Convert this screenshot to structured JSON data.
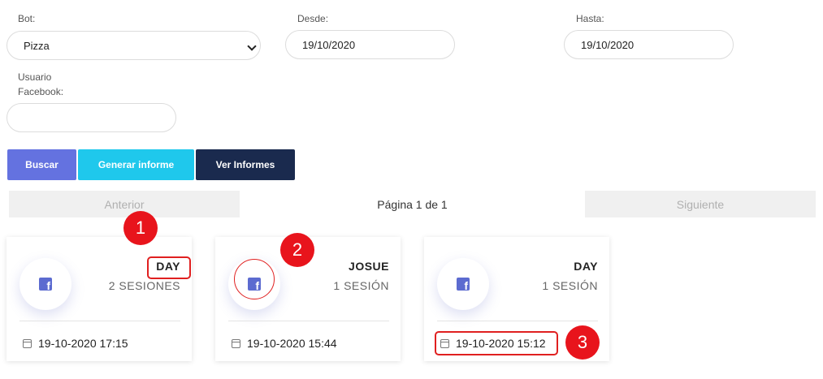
{
  "filters": {
    "bot_label": "Bot:",
    "bot_value": "Pizza",
    "desde_label": "Desde:",
    "desde_value": "19/10/2020",
    "hasta_label": "Hasta:",
    "hasta_value": "19/10/2020",
    "usuario_label_1": "Usuario",
    "usuario_label_2": "Facebook:",
    "usuario_value": ""
  },
  "buttons": {
    "buscar": "Buscar",
    "generar": "Generar informe",
    "ver": "Ver Informes"
  },
  "pager": {
    "prev": "Anterior",
    "info": "Página 1 de 1",
    "next": "Siguiente"
  },
  "cards": [
    {
      "name": "DAY",
      "sessions": "2 SESIONES",
      "date": "19-10-2020 17:15"
    },
    {
      "name": "JOSUE",
      "sessions": "1 SESIÓN",
      "date": "19-10-2020 15:44"
    },
    {
      "name": "DAY",
      "sessions": "1 SESIÓN",
      "date": "19-10-2020 15:12"
    }
  ],
  "annotations": [
    "1",
    "2",
    "3"
  ],
  "colors": {
    "buscar": "#6472e0",
    "generar": "#1fc8ec",
    "ver": "#1a2a4e",
    "facebook": "#5c6bd0",
    "annotation": "#e8141c"
  },
  "icons": [
    "chevron-down-icon",
    "facebook-icon",
    "calendar-icon"
  ]
}
